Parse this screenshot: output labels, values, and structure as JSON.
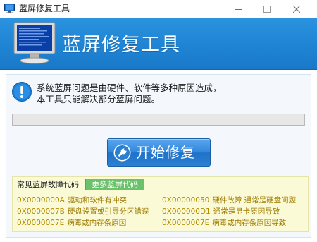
{
  "window": {
    "title": "蓝屏修复工具",
    "min_glyph": "—",
    "max_glyph": "☐",
    "close_glyph": "✕"
  },
  "banner": {
    "title": "蓝屏修复工具"
  },
  "info": {
    "line1": "系统蓝屏问题是由硬件、软件等多种原因造成，",
    "line2": "本工具只能解决部分蓝屏问题。"
  },
  "progress": {
    "value": 0
  },
  "start_button": {
    "label": "开始修复"
  },
  "codes": {
    "title": "常见蓝屏故障代码",
    "more_label": "更多蓝屏代码",
    "items": [
      {
        "code": "0X0000000A",
        "desc": "驱动和软件有冲突"
      },
      {
        "code": "0X00000050",
        "desc": "硬件故障 通常是硬盘问题"
      },
      {
        "code": "0X0000007B",
        "desc": "硬盘设置或引导分区错误"
      },
      {
        "code": "0X000000D1",
        "desc": "通常是显卡原因导致"
      },
      {
        "code": "0X0000007E",
        "desc": "病毒或内存条原因"
      },
      {
        "code": "0X0000007E",
        "desc": "病毒或内存条原因导致"
      }
    ]
  },
  "colors": {
    "banner": "#1f84d4",
    "accent": "#3388dc",
    "code_text": "#b38a00",
    "more_button": "#6cc26c"
  },
  "icons": {
    "app": "monitor-icon",
    "banner": "bluescreen-monitor-icon",
    "info": "info-icon",
    "start": "wrench-icon"
  }
}
